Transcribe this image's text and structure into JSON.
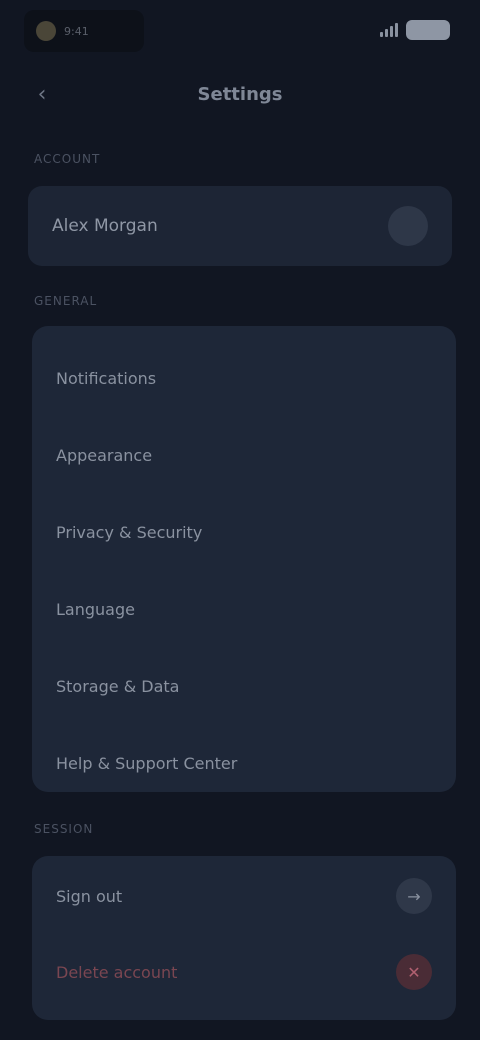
{
  "status_bar": {
    "time": "9:41"
  },
  "header": {
    "title": "Settings"
  },
  "sections": {
    "account_label": "Account",
    "general_label": "General",
    "session_label": "Session"
  },
  "account": {
    "name": "Alex Morgan"
  },
  "settings_items": [
    {
      "label": "Notifications"
    },
    {
      "label": "Appearance"
    },
    {
      "label": "Privacy & Security"
    },
    {
      "label": "Language"
    },
    {
      "label": "Storage & Data"
    },
    {
      "label": "Help & Support Center"
    }
  ],
  "account_actions": {
    "sign_out": "Sign out",
    "delete_account": "Delete account"
  },
  "colors": {
    "background": "#111622",
    "card": "#1e2738",
    "danger": "#7a4651"
  }
}
